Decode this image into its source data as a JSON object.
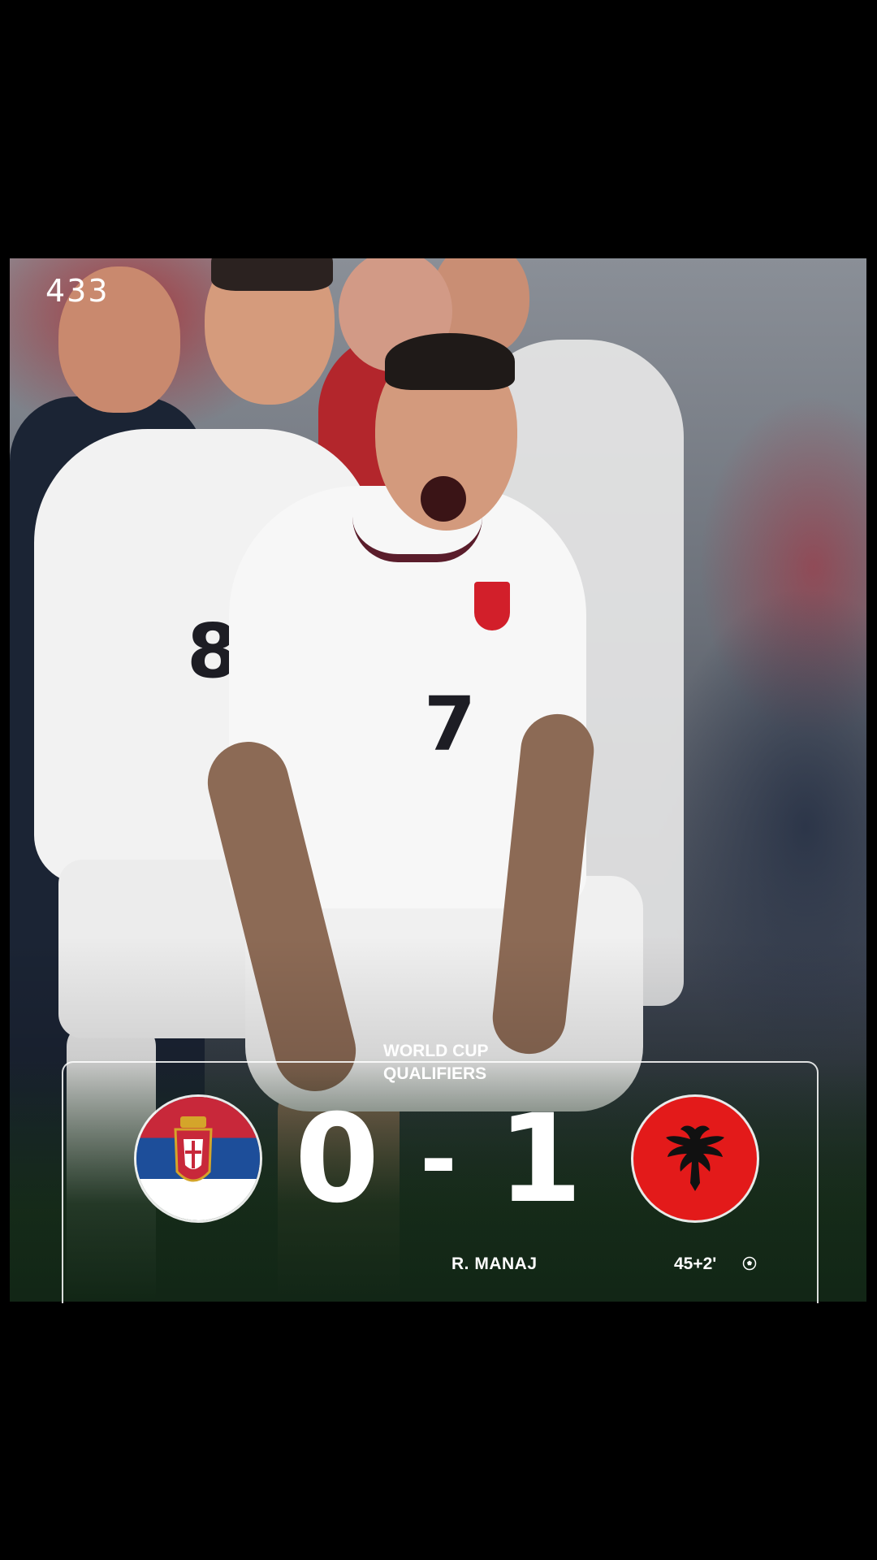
{
  "brand": {
    "logo_text": "433"
  },
  "match": {
    "competition_line1": "WORLD CUP",
    "competition_line2": "QUALIFIERS",
    "home_team_flag": "serbia-flag",
    "away_team_flag": "albania-flag",
    "home_score": "0",
    "separator": "-",
    "away_score": "1",
    "goal": {
      "scorer": "R. MANAJ",
      "minute": "45+2'",
      "icon": "football-icon"
    }
  },
  "photo": {
    "jersey_numbers": [
      "8",
      "7"
    ]
  },
  "colors": {
    "background": "#000000",
    "card_border": "#ffffff",
    "serbia_red": "#c8283a",
    "serbia_blue": "#1d4e9a",
    "albania_red": "#e31a1a"
  }
}
